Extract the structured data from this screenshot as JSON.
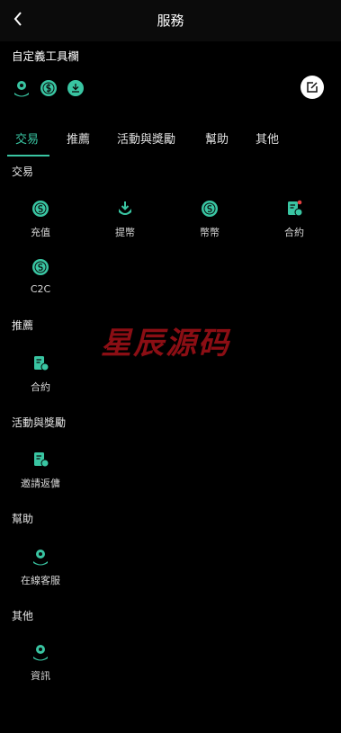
{
  "header": {
    "title": "服務",
    "back_icon": "chevron-left-icon"
  },
  "toolbar": {
    "title": "自定義工具欄",
    "icons": [
      "headset-icon",
      "coin-icon",
      "download-icon"
    ],
    "edit_icon": "edit-icon"
  },
  "tabs": [
    {
      "label": "交易",
      "active": true
    },
    {
      "label": "推薦",
      "active": false
    },
    {
      "label": "活動與獎勵",
      "active": false
    },
    {
      "label": "幫助",
      "active": false
    },
    {
      "label": "其他",
      "active": false
    }
  ],
  "sections": [
    {
      "title": "交易",
      "items": [
        {
          "label": "充值",
          "icon": "coin-icon"
        },
        {
          "label": "提幣",
          "icon": "download-icon"
        },
        {
          "label": "幣幣",
          "icon": "coin-icon"
        },
        {
          "label": "合約",
          "icon": "document-icon"
        },
        {
          "label": "C2C",
          "icon": "coin-icon"
        }
      ]
    },
    {
      "title": "推薦",
      "items": [
        {
          "label": "合約",
          "icon": "document-icon"
        }
      ]
    },
    {
      "title": "活動與獎勵",
      "items": [
        {
          "label": "邀請返傭",
          "icon": "document-icon"
        }
      ]
    },
    {
      "title": "幫助",
      "items": [
        {
          "label": "在線客服",
          "icon": "headset-icon"
        }
      ]
    },
    {
      "title": "其他",
      "items": [
        {
          "label": "資訊",
          "icon": "headset-icon"
        }
      ]
    }
  ],
  "watermark": "星辰源码",
  "colors": {
    "accent": "#39c5a2",
    "background": "#000000",
    "header": "#0b0b0b",
    "watermark": "#8b0e14"
  }
}
